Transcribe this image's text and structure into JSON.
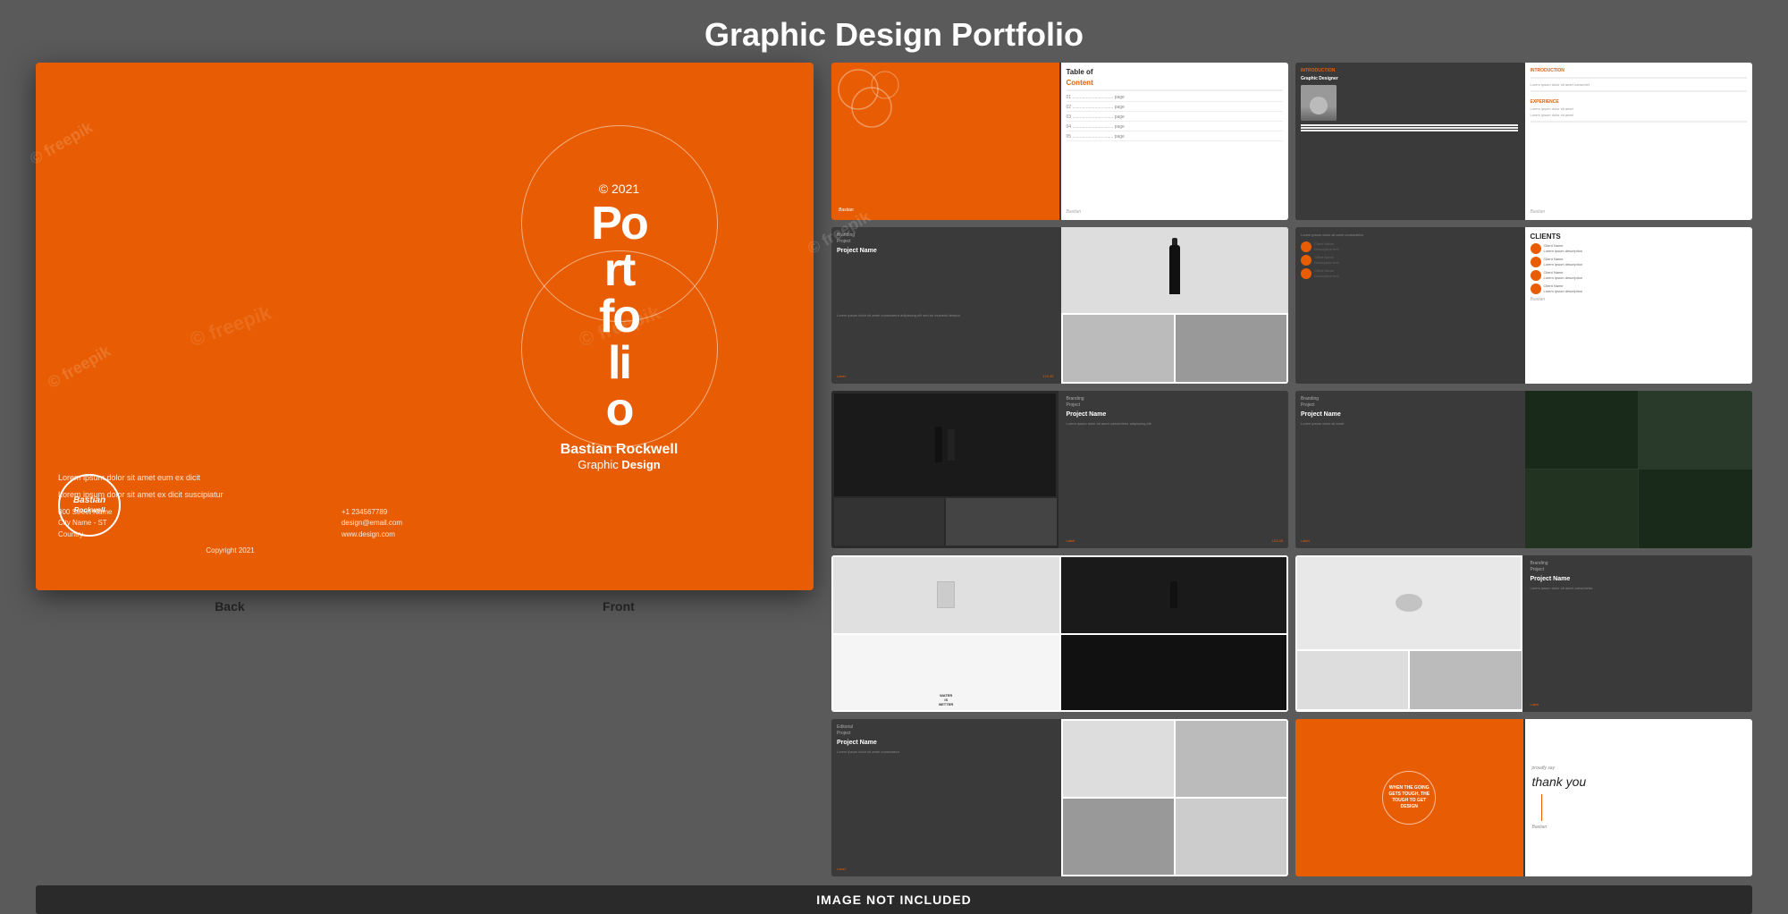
{
  "page": {
    "title": "Graphic Design Portfolio",
    "bottom_bar": "IMAGE NOT INCLUDED"
  },
  "cover": {
    "copyright_year": "© 2021",
    "portfolio_lines": [
      "Po",
      "rt",
      "fo",
      "li",
      "o"
    ],
    "author_name": "Bastian Rockwell",
    "author_subtitle_regular": "Graphic ",
    "author_subtitle_bold": "Design",
    "back_label": "Back",
    "front_label": "Front",
    "logo_text": "Bastian\nRockwell",
    "tagline_line1": "Lorem ipsum dolor sit amet eum ex dicit",
    "tagline_line2": "Lorem ipsum dolor sit amet ex dicit suscipiatur",
    "address1": "000 Street Name",
    "address2": "City Name - ST",
    "address3": "Country",
    "phone": "+1 234567789",
    "email": "design@email.com",
    "website": "www.design.com",
    "copyright": "Copyright 2021"
  },
  "thumbnails": {
    "toc": {
      "title": "Table of",
      "title_orange": "Content",
      "items": [
        "01",
        "02",
        "03",
        "04",
        "05"
      ]
    },
    "about": {
      "label": "Graphic Designer",
      "orange_label": "INTRODUCTION"
    },
    "clients": {
      "title": "CLIENTS",
      "items": [
        "Client Name",
        "Client Name",
        "Client Name",
        "Client Name"
      ]
    },
    "branding1": {
      "category": "Branding\nProject",
      "name": "Project Name"
    },
    "branding2": {
      "category": "Branding\nProject",
      "name": "Project Name"
    },
    "branding3": {
      "category": "Branding\nProject",
      "name": "Project Name"
    },
    "editorial": {
      "category": "Editorial\nProject",
      "name": "Project Name"
    },
    "thankyou": {
      "quote": "WHEN THE\nGOING GETS\nTOUGH,\nTHE TOUGH\nTO GET\nDESIGN",
      "proudly": "proudly say",
      "text": "thank you",
      "signature": "Bastian"
    }
  },
  "watermarks": [
    "freepik",
    "freepik",
    "freepik"
  ]
}
